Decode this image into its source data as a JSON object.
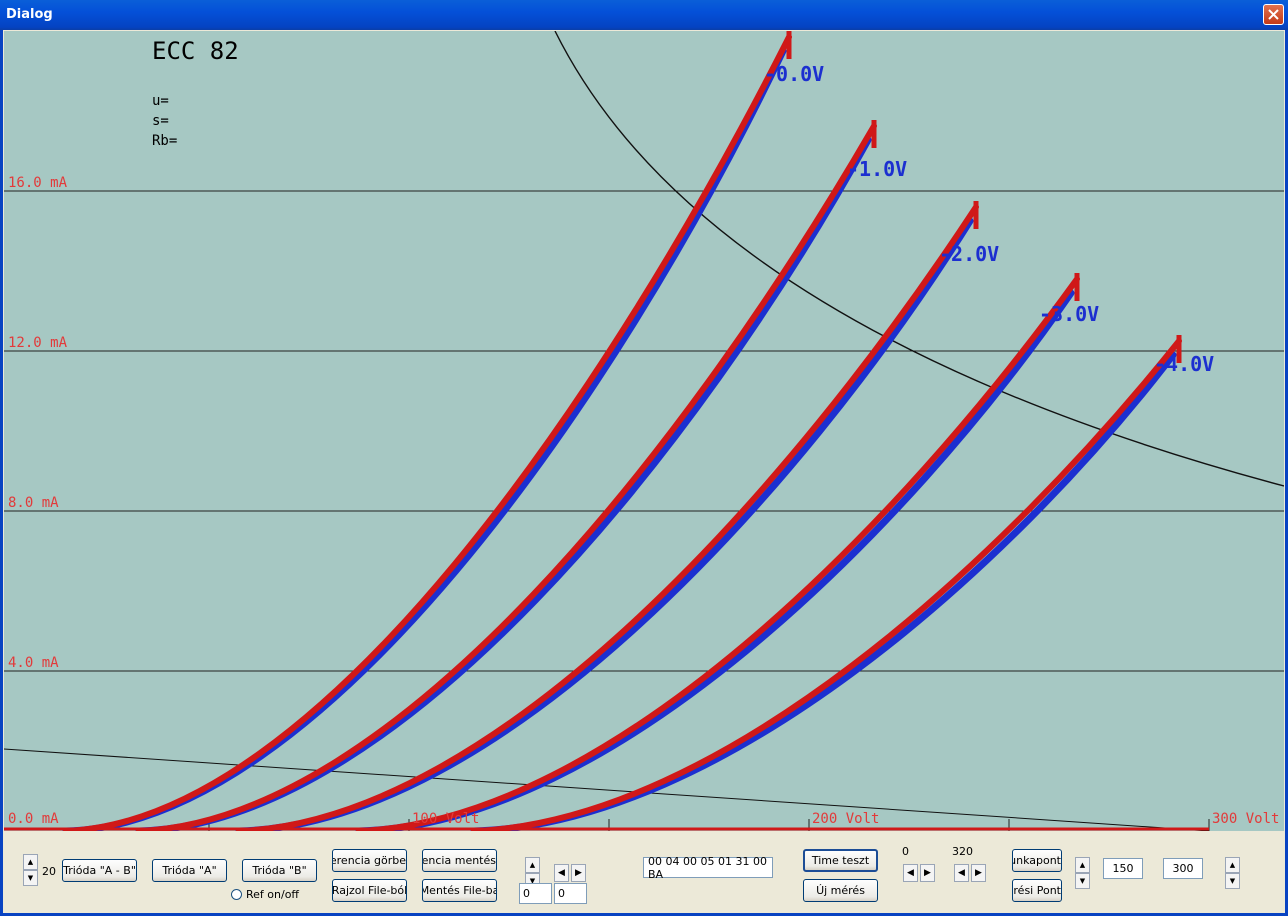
{
  "window": {
    "title": "Dialog"
  },
  "plot": {
    "tube": "ECC 82",
    "params": [
      "u=",
      "s=",
      "Rb="
    ],
    "y_labels": [
      "16.0 mA",
      "12.0 mA",
      "8.0 mA",
      "4.0 mA",
      "0.0 mA"
    ],
    "x_labels": [
      "100 Volt",
      "200 Volt",
      "300 Volt"
    ],
    "curve_labels": [
      "-0.0V",
      "-1.0V",
      "-2.0V",
      "-3.0V",
      "-4.0V"
    ],
    "colors": {
      "background": "#a6c8c3",
      "red": "#d01818",
      "blue": "#1c2fd0",
      "label": "#e23a3a"
    }
  },
  "controls": {
    "spin_value": "20",
    "trioda_ab": "Trióda \"A - B\"",
    "trioda_a": "Trióda  \"A\"",
    "trioda_b": "Trióda  \"B\"",
    "ref_onoff": "Ref on/off",
    "referencia_gorbe": "Referencia görbe",
    "rajzol_file": "Rajzol File-ból",
    "referencia_mentes": "Referencia mentés",
    "mentes_file": "Mentés File-ba",
    "field_left1": "0",
    "field_left2": "0",
    "hex_field": "00 04 00 05 01 31 00 BA",
    "time_teszt": "Time teszt",
    "uj_meres": "Új mérés",
    "val_0": "0",
    "val_320": "320",
    "munkapont": "Munkapont",
    "meresi_pont": "Mérési Pont",
    "field_150": "150",
    "field_300": "300"
  }
}
